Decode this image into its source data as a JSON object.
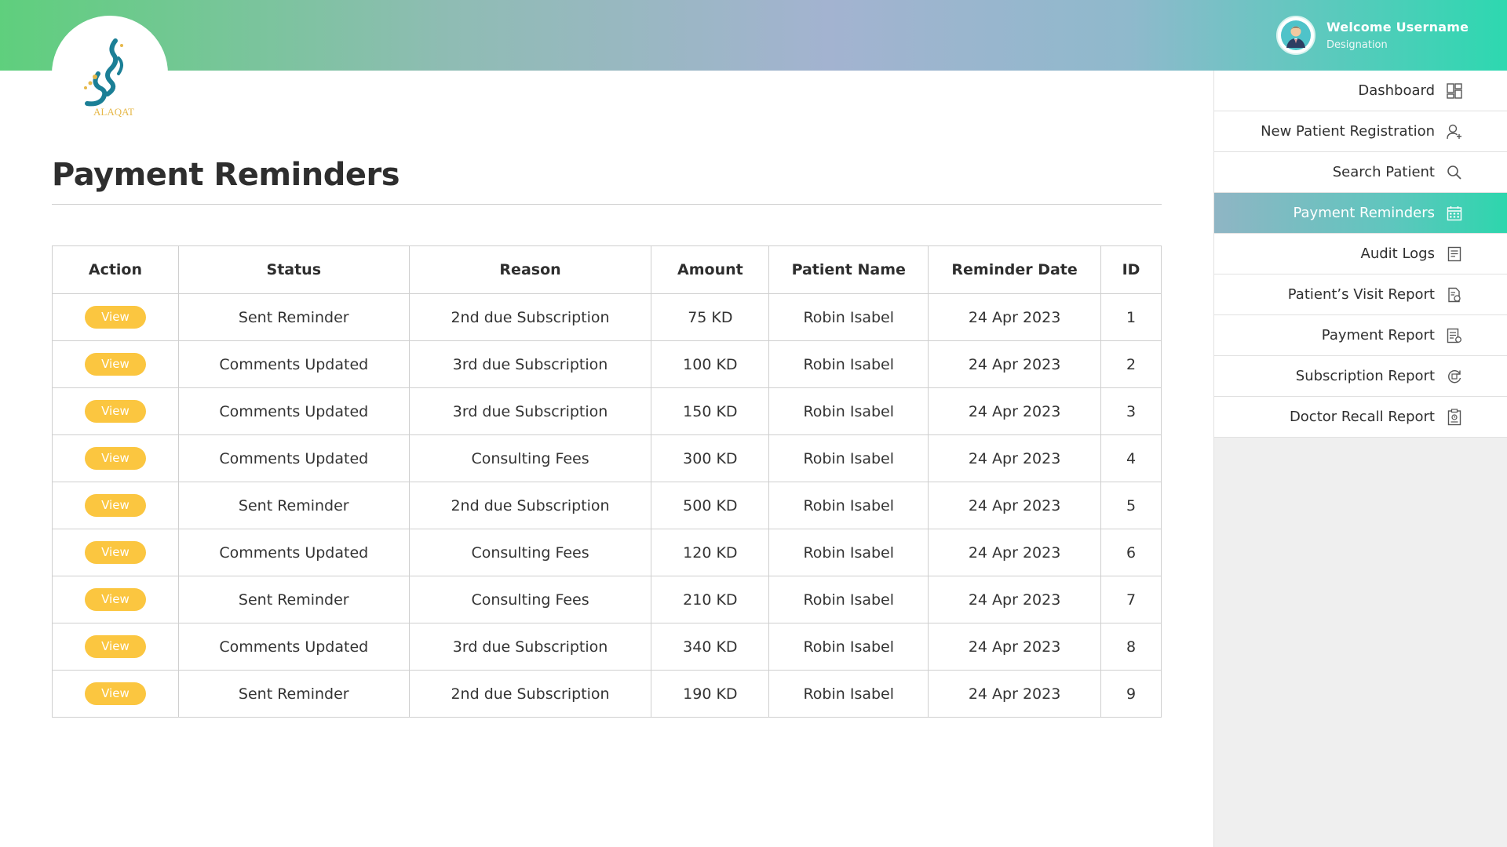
{
  "header": {
    "welcome": "Welcome Username",
    "designation": "Designation"
  },
  "logo": {
    "text": "ALAQAT"
  },
  "page": {
    "title": "Payment Reminders"
  },
  "table": {
    "columns": [
      "Action",
      "Status",
      "Reason",
      "Amount",
      "Patient Name",
      "Reminder Date",
      "ID"
    ],
    "view_label": "View",
    "rows": [
      {
        "status": "Sent Reminder",
        "reason": "2nd due Subscription",
        "amount": "75 KD",
        "patient": "Robin Isabel",
        "date": "24 Apr 2023",
        "id": "1"
      },
      {
        "status": "Comments Updated",
        "reason": "3rd due Subscription",
        "amount": "100 KD",
        "patient": "Robin Isabel",
        "date": "24 Apr 2023",
        "id": "2"
      },
      {
        "status": "Comments Updated",
        "reason": "3rd due Subscription",
        "amount": "150 KD",
        "patient": "Robin Isabel",
        "date": "24 Apr 2023",
        "id": "3"
      },
      {
        "status": "Comments Updated",
        "reason": "Consulting Fees",
        "amount": "300 KD",
        "patient": "Robin Isabel",
        "date": "24 Apr 2023",
        "id": "4"
      },
      {
        "status": "Sent Reminder",
        "reason": "2nd due Subscription",
        "amount": "500 KD",
        "patient": "Robin Isabel",
        "date": "24 Apr 2023",
        "id": "5"
      },
      {
        "status": "Comments Updated",
        "reason": "Consulting Fees",
        "amount": "120 KD",
        "patient": "Robin Isabel",
        "date": "24 Apr 2023",
        "id": "6"
      },
      {
        "status": "Sent Reminder",
        "reason": "Consulting Fees",
        "amount": "210 KD",
        "patient": "Robin Isabel",
        "date": "24 Apr 2023",
        "id": "7"
      },
      {
        "status": "Comments Updated",
        "reason": "3rd due Subscription",
        "amount": "340 KD",
        "patient": "Robin Isabel",
        "date": "24 Apr 2023",
        "id": "8"
      },
      {
        "status": "Sent Reminder",
        "reason": "2nd due Subscription",
        "amount": "190 KD",
        "patient": "Robin Isabel",
        "date": "24 Apr 2023",
        "id": "9"
      }
    ]
  },
  "sidebar": {
    "items": [
      {
        "label": "Dashboard",
        "icon": "dashboard-icon",
        "active": false
      },
      {
        "label": "New Patient Registration",
        "icon": "add-user-icon",
        "active": false
      },
      {
        "label": "Search Patient",
        "icon": "search-icon",
        "active": false
      },
      {
        "label": "Payment Reminders",
        "icon": "calendar-icon",
        "active": true
      },
      {
        "label": "Audit Logs",
        "icon": "document-icon",
        "active": false
      },
      {
        "label": "Patient’s Visit Report",
        "icon": "report-icon",
        "active": false
      },
      {
        "label": "Payment Report",
        "icon": "payment-report-icon",
        "active": false
      },
      {
        "label": "Subscription Report",
        "icon": "subscription-icon",
        "active": false
      },
      {
        "label": "Doctor Recall Report",
        "icon": "clipboard-icon",
        "active": false
      }
    ]
  },
  "colors": {
    "view_button": "#fbc640",
    "active_nav_start": "#8fb5c4",
    "active_nav_end": "#2dd6ad",
    "logo_teal": "#1b7f96",
    "logo_gold": "#e6b84a"
  }
}
